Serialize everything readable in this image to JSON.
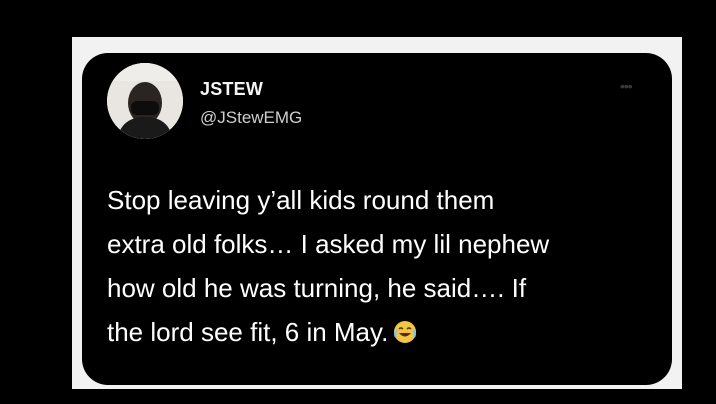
{
  "tweet": {
    "author": {
      "display_name": "JSTEW",
      "handle": "@JStewEMG",
      "avatar_icon": "profile-photo"
    },
    "more_glyph": "•••",
    "text_lines": [
      "Stop leaving y’all kids round them",
      "extra old folks… I asked my lil nephew",
      "how old he was turning, he said…. If",
      "the lord see fit, 6 in May."
    ],
    "trailing_emoji": "tears-of-joy-emoji"
  },
  "colors": {
    "background": "#000000",
    "frame": "#f2f2f2",
    "card": "#000000",
    "text": "#ffffff",
    "handle": "#cfcfcf"
  }
}
